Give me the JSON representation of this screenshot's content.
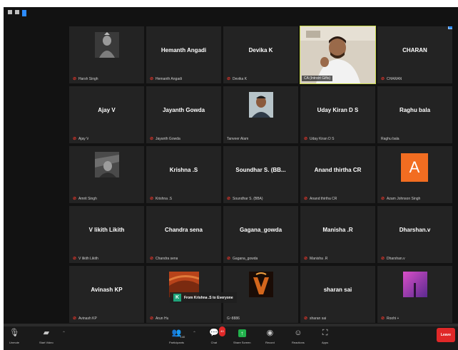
{
  "participants": [
    {
      "name": "",
      "label": "Harsh Singh",
      "avatar": "photo",
      "muted": true
    },
    {
      "name": "Hemanth Angadi",
      "label": "Hemanth Angadi",
      "muted": true
    },
    {
      "name": "Devika K",
      "label": "Devika K",
      "muted": true
    },
    {
      "name": "",
      "label": "CA (Intrstrt Gifts)",
      "avatar": "camera",
      "active_speaker": true,
      "muted": false
    },
    {
      "name": "CHARAN",
      "label": "CHARAN",
      "muted": true
    },
    {
      "name": "Ajay V",
      "label": "Ajay V",
      "muted": true
    },
    {
      "name": "Jayanth Gowda",
      "label": "Jayanth Gowda",
      "muted": true
    },
    {
      "name": "",
      "label": "Tanveer Alam",
      "avatar": "photo",
      "muted": false
    },
    {
      "name": "Uday Kiran D S",
      "label": "Uday Kiran D S",
      "muted": true
    },
    {
      "name": "Raghu bala",
      "label": "Raghu bala",
      "muted": false
    },
    {
      "name": "",
      "label": "Amrit Singh",
      "avatar": "photo",
      "muted": true
    },
    {
      "name": "Krishna .S",
      "label": "Krishna .S",
      "muted": true
    },
    {
      "name": "Soundhar S. (BB...",
      "label": "Soundhar S. (BBA)",
      "muted": true
    },
    {
      "name": "Anand thirtha CR",
      "label": "Anand thirtha CR",
      "muted": true
    },
    {
      "name": "",
      "label": "Azam Johnson Singh",
      "avatar": "letter",
      "letter": "A",
      "muted": true
    },
    {
      "name": "V likith Likith",
      "label": "V likith Likith",
      "muted": true
    },
    {
      "name": "Chandra sena",
      "label": "Chandra sena",
      "muted": true
    },
    {
      "name": "Gagana_gowda",
      "label": "Gagana_gowda",
      "muted": true
    },
    {
      "name": "Manisha .R",
      "label": "Manisha .R",
      "muted": true
    },
    {
      "name": "Dharshan.v",
      "label": "Dharshan.v",
      "muted": true
    },
    {
      "name": "Avinash KP",
      "label": "Avinash KP",
      "muted": true
    },
    {
      "name": "",
      "label": "Arun Hu",
      "avatar": "photo",
      "muted": true
    },
    {
      "name": "",
      "label": "G~8886",
      "avatar": "photo",
      "muted": false
    },
    {
      "name": "sharan sai",
      "label": "sharan sai",
      "muted": true
    },
    {
      "name": "",
      "label": "Roohi +",
      "avatar": "photo",
      "muted": true
    }
  ],
  "chat_notification": {
    "avatar_letter": "K",
    "text": "From Krishna .S to Everyone"
  },
  "toolbar": {
    "unmute": "Unmute",
    "start_video": "Start Video",
    "participants": "Participants",
    "participants_count": "140",
    "chat": "Chat",
    "chat_badge": "40",
    "share_screen": "Share Screen",
    "record": "Record",
    "reactions": "Reactions",
    "apps": "Apps",
    "leave": "Leave"
  },
  "colors": {
    "background": "#121212",
    "tile": "#232323",
    "accent_blue": "#2d8cff",
    "active_speaker": "#c8d84a",
    "share_green": "#22b14c",
    "leave_red": "#e02828",
    "muted_red": "#e0352b",
    "avatar_orange": "#f26d21"
  }
}
